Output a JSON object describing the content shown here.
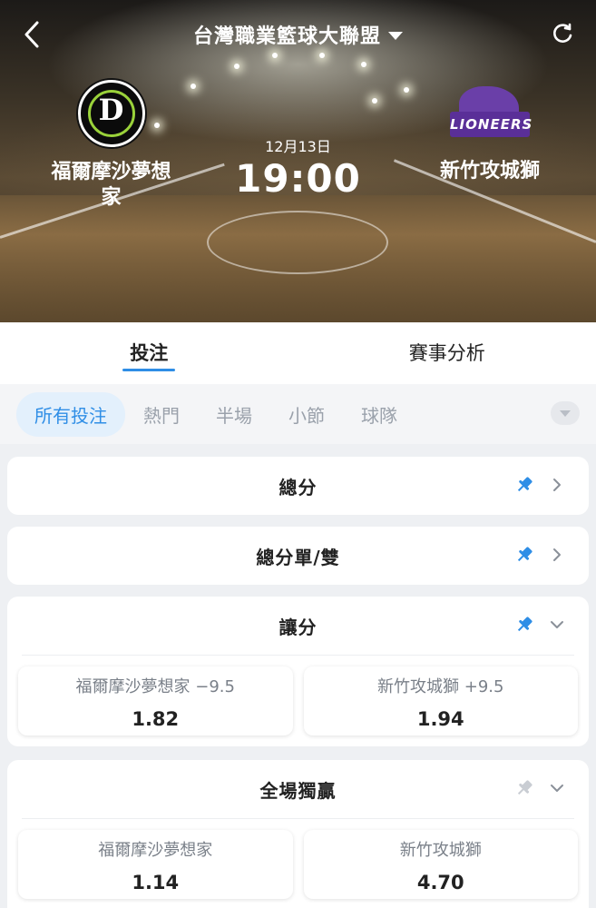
{
  "header": {
    "league_title": "台灣職業籃球大聯盟",
    "home_team": "福爾摩沙夢想家",
    "away_team": "新竹攻城獅",
    "date": "12月13日",
    "time": "19:00",
    "home_logo_text": "D",
    "away_logo_text": "LIONEERS"
  },
  "tabs": [
    {
      "label": "投注",
      "active": true
    },
    {
      "label": "賽事分析",
      "active": false
    }
  ],
  "filters": [
    {
      "label": "所有投注",
      "active": true
    },
    {
      "label": "熱門",
      "active": false
    },
    {
      "label": "半場",
      "active": false
    },
    {
      "label": "小節",
      "active": false
    },
    {
      "label": "球隊",
      "active": false
    }
  ],
  "markets": [
    {
      "title": "總分",
      "pinned": true,
      "expanded": false
    },
    {
      "title": "總分單/雙",
      "pinned": true,
      "expanded": false
    },
    {
      "title": "讓分",
      "pinned": true,
      "expanded": true,
      "options": [
        {
          "label": "福爾摩沙夢想家 −9.5",
          "odds": "1.82"
        },
        {
          "label": "新竹攻城獅 +9.5",
          "odds": "1.94"
        }
      ]
    },
    {
      "title": "全場獨贏",
      "pinned": false,
      "expanded": true,
      "options": [
        {
          "label": "福爾摩沙夢想家",
          "odds": "1.14"
        },
        {
          "label": "新竹攻城獅",
          "odds": "4.70"
        }
      ]
    }
  ],
  "colors": {
    "accent": "#2f8ee6",
    "pin_active": "#2f8ee6",
    "pin_inactive": "#c9cdd3"
  }
}
